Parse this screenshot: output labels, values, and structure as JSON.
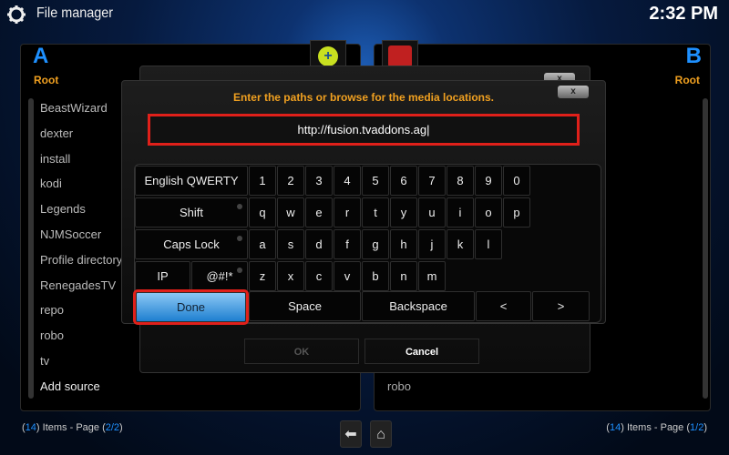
{
  "header": {
    "title": "File manager",
    "clock": "2:32 PM",
    "icon": "gear-icon"
  },
  "left_panel": {
    "letter": "A",
    "path": "Root",
    "items": [
      "BeastWizard",
      "dexter",
      "install",
      "kodi",
      "Legends",
      "NJMSoccer",
      "Profile directory",
      "RenegadesTV",
      "repo",
      "robo",
      "tv",
      "Add source"
    ],
    "footer": {
      "count": "14",
      "pre": "Items - Page",
      "page": "2/2"
    }
  },
  "right_panel": {
    "letter": "B",
    "path": "Root",
    "items": [
      "robo"
    ],
    "footer": {
      "count": "14",
      "pre": "Items - Page",
      "page": "1/2"
    }
  },
  "dialog": {
    "prompt": "Enter the paths or browse for the media locations.",
    "input_value": "http://fusion.tvaddons.ag|",
    "close": "x",
    "ok": "OK",
    "cancel": "Cancel"
  },
  "keyboard": {
    "layout": "English QWERTY",
    "shift": "Shift",
    "caps": "Caps Lock",
    "ip": "IP",
    "symbols": "@#!*",
    "row0": [
      "1",
      "2",
      "3",
      "4",
      "5",
      "6",
      "7",
      "8",
      "9",
      "0"
    ],
    "row1": [
      "q",
      "w",
      "e",
      "r",
      "t",
      "y",
      "u",
      "i",
      "o",
      "p"
    ],
    "row2": [
      "a",
      "s",
      "d",
      "f",
      "g",
      "h",
      "j",
      "k",
      "l"
    ],
    "row3": [
      "z",
      "x",
      "c",
      "v",
      "b",
      "n",
      "m"
    ],
    "done": "Done",
    "space": "Space",
    "backspace": "Backspace",
    "left": "<",
    "right": ">"
  },
  "colors": {
    "accent": "#1e90ff",
    "label": "#f0a020",
    "highlight": "#e0201a"
  }
}
